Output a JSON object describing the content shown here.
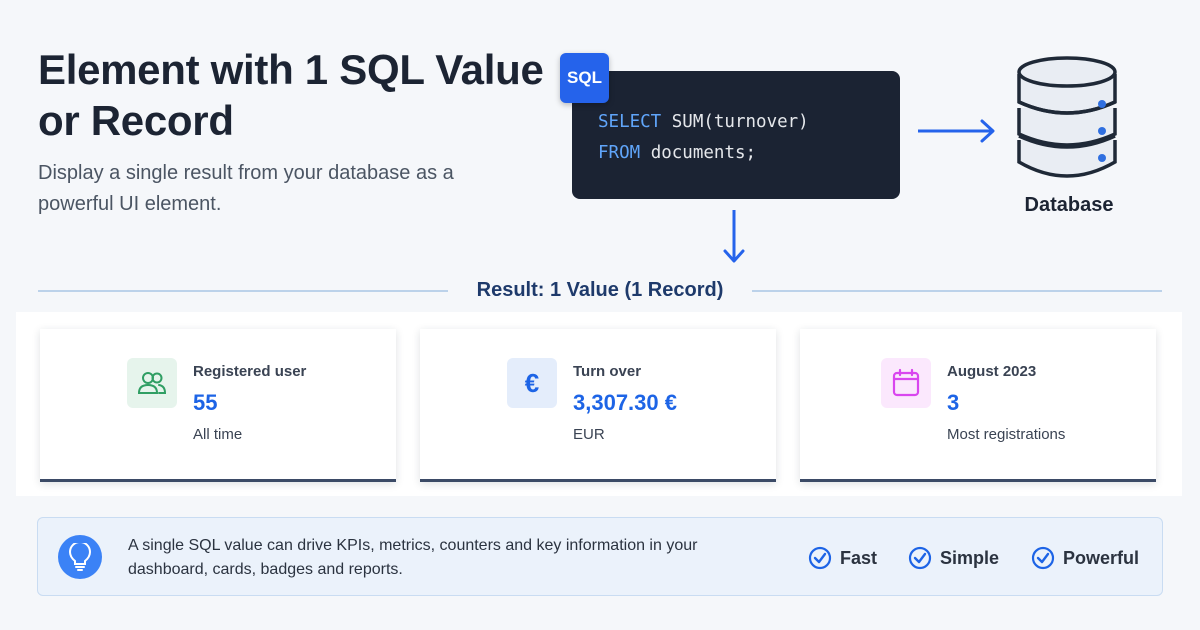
{
  "header": {
    "title": "Element with 1 SQL Value or Record",
    "subtitle": "Display a single result from your database as a powerful UI element."
  },
  "sql": {
    "badge": "SQL",
    "line1_keyword": "SELECT",
    "line1_rest": " SUM(turnover)",
    "line2_keyword": "FROM",
    "line2_rest": " documents;"
  },
  "database": {
    "label": "Database",
    "icon": "database-icon"
  },
  "result": {
    "label": "Result: 1 Value (1 Record)"
  },
  "cards": [
    {
      "icon": "users-icon",
      "icon_color": "#2f9e63",
      "icon_bg": "#e6f4ec",
      "label": "Registered user",
      "value": "55",
      "sub": "All time"
    },
    {
      "icon": "euro-icon",
      "icon_color": "#1d64e6",
      "icon_bg": "#e4edfb",
      "label": "Turn over",
      "value": "3,307.30 €",
      "sub": "EUR"
    },
    {
      "icon": "calendar-icon",
      "icon_color": "#d946ef",
      "icon_bg": "#fbe8fd",
      "label": "August 2023",
      "value": "3",
      "sub": "Most registrations"
    }
  ],
  "info": {
    "icon": "lightbulb-icon",
    "text": "A single SQL value can drive KPIs, metrics, counters and key information in your dashboard, cards, badges and reports.",
    "features": [
      "Fast",
      "Simple",
      "Powerful"
    ]
  },
  "colors": {
    "accent": "#2563eb",
    "code_bg": "#1b2333",
    "value_blue": "#1d64e6"
  }
}
